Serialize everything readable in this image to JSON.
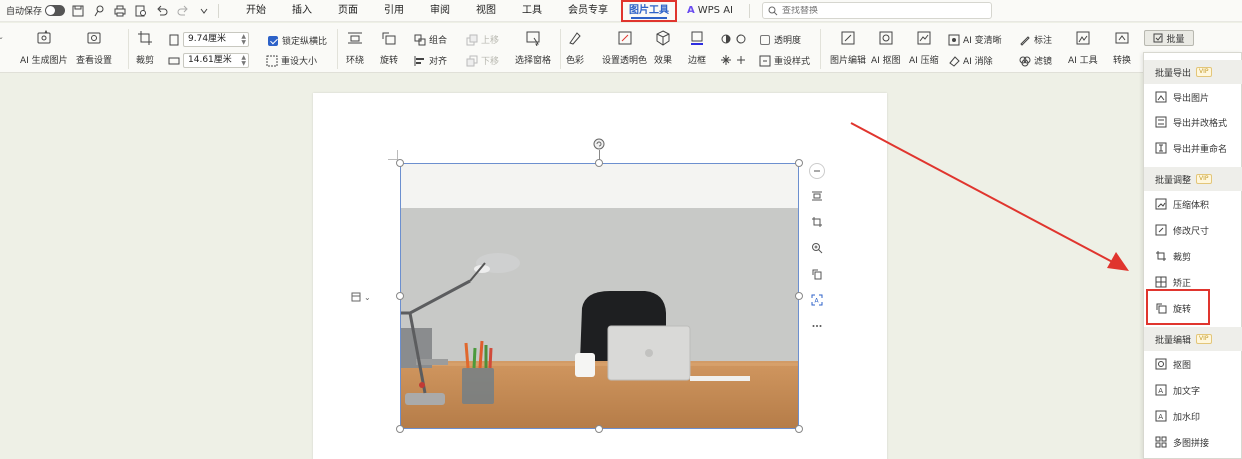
{
  "topbar": {
    "autosave_label": "自动保存",
    "tabs": [
      "开始",
      "插入",
      "页面",
      "引用",
      "审阅",
      "视图",
      "工具",
      "会员专享"
    ],
    "active_tab": "图片工具",
    "wps_ai": "WPS AI",
    "search_placeholder": "查找替换"
  },
  "ribbon": {
    "ai_generate": "AI 生成图片",
    "view_settings": "查看设置",
    "crop": "裁剪",
    "width_value": "9.74厘米",
    "height_value": "14.61厘米",
    "lock_ratio": "锁定纵横比",
    "reset_size": "重设大小",
    "wrap": "环绕",
    "rotate": "旋转",
    "group": "组合",
    "align": "对齐",
    "move_up": "上移",
    "move_down": "下移",
    "selection_pane": "选择窗格",
    "color": "色彩",
    "transparent_color": "设置透明色",
    "effects": "效果",
    "border": "边框",
    "transparency": "透明度",
    "reset_style": "重设样式",
    "image_edit": "图片编辑",
    "ai_cutout": "AI 抠图",
    "ai_compress": "AI 压缩",
    "ai_sharpen": "AI 变清晰",
    "ai_remove": "AI 消除",
    "annotate": "标注",
    "filter": "滤镜",
    "ai_tools": "AI 工具",
    "convert": "转换",
    "batch": "批量"
  },
  "dropdown": {
    "vip_badge": "VIP",
    "export_header": "批量导出",
    "export_items": [
      "导出图片",
      "导出并改格式",
      "导出并重命名"
    ],
    "adjust_header": "批量调整",
    "adjust_items": [
      "压缩体积",
      "修改尺寸",
      "裁剪",
      "矫正",
      "旋转"
    ],
    "edit_header": "批量编辑",
    "edit_items": [
      "抠图",
      "加文字",
      "加水印",
      "多图拼接"
    ]
  },
  "colors": {
    "accent_blue": "#2d62c8",
    "highlight_red": "#e0352e",
    "background": "#eef0e6"
  }
}
